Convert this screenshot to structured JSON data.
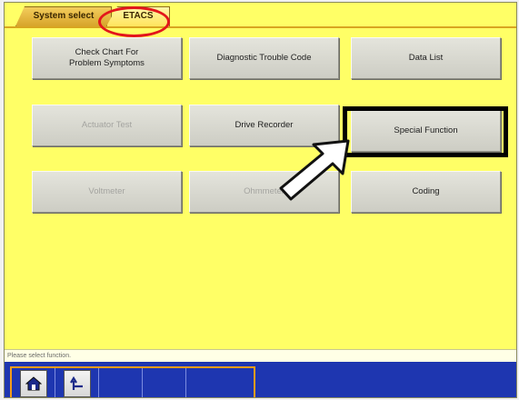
{
  "tabs": {
    "system_select": "System select",
    "etacs": "ETACS"
  },
  "functions": [
    {
      "label": "Check Chart For\nProblem Symptoms",
      "enabled": true
    },
    {
      "label": "Diagnostic Trouble Code",
      "enabled": true
    },
    {
      "label": "Data List",
      "enabled": true
    },
    {
      "label": "Actuator Test",
      "enabled": false
    },
    {
      "label": "Drive Recorder",
      "enabled": true
    },
    {
      "label": "Special Function",
      "enabled": true
    },
    {
      "label": "Voltmeter",
      "enabled": false
    },
    {
      "label": "Ohmmeter",
      "enabled": false
    },
    {
      "label": "Coding",
      "enabled": true
    }
  ],
  "status": {
    "message": "Please select function."
  },
  "toolbar": {
    "buttons": [
      {
        "icon": "home-icon"
      },
      {
        "icon": "return-icon"
      }
    ]
  },
  "colors": {
    "background": "#ffff66",
    "highlight_circle": "#e3161b",
    "bottom_bar": "#1e36b0",
    "dock_border": "#f39c1a"
  }
}
